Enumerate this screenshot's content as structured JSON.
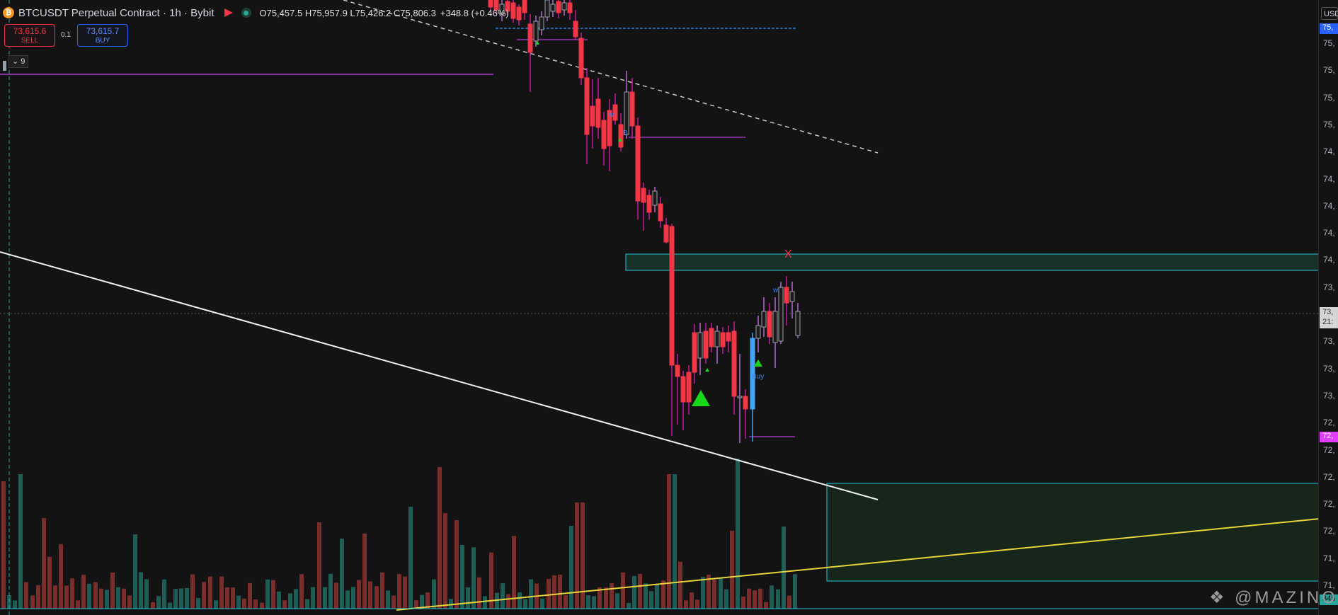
{
  "header": {
    "coin_glyph": "₿",
    "title": "BTCUSDT Perpetual Contract · 1h · Bybit",
    "ohlc": "O75,457.5  H75,957.9  L75,426.2  C75,806.3",
    "change": "+348.8 (+0.46%)"
  },
  "trade": {
    "sell_price": "73,615.6",
    "sell_label": "SELL",
    "quantity": "0.1",
    "buy_price": "73,615.7",
    "buy_label": "BUY",
    "collapse_label": "⌄ 9"
  },
  "price_axis": {
    "unit_label": "USD",
    "ticks": [
      "75,",
      "75,",
      "75,",
      "75,",
      "74,",
      "74,",
      "74,",
      "74,",
      "74,",
      "73,",
      "73,",
      "73,",
      "73,",
      "73,",
      "72,",
      "72,",
      "72,",
      "72,",
      "72,",
      "71,",
      "71,"
    ],
    "current_price_label": "73,",
    "countdown_label": "21:",
    "blue_label": "75,",
    "magenta_label": "72,",
    "bottom_label": "345"
  },
  "markers": {
    "x_mark": "X",
    "buy_label": "Buy",
    "w_label": "w",
    "b_label": "B"
  },
  "watermark": "❖ @MAZINO",
  "colors": {
    "bull": "#9aa0a8",
    "bear": "#f23645",
    "bull_blue": "#42a5f5",
    "volume_up": "#1e5d56",
    "volume_down": "#7a2e2b",
    "accent_magenta": "#e040fb",
    "zone_border": "#26c6da",
    "trendline_yellow": "#e6d43a"
  }
}
